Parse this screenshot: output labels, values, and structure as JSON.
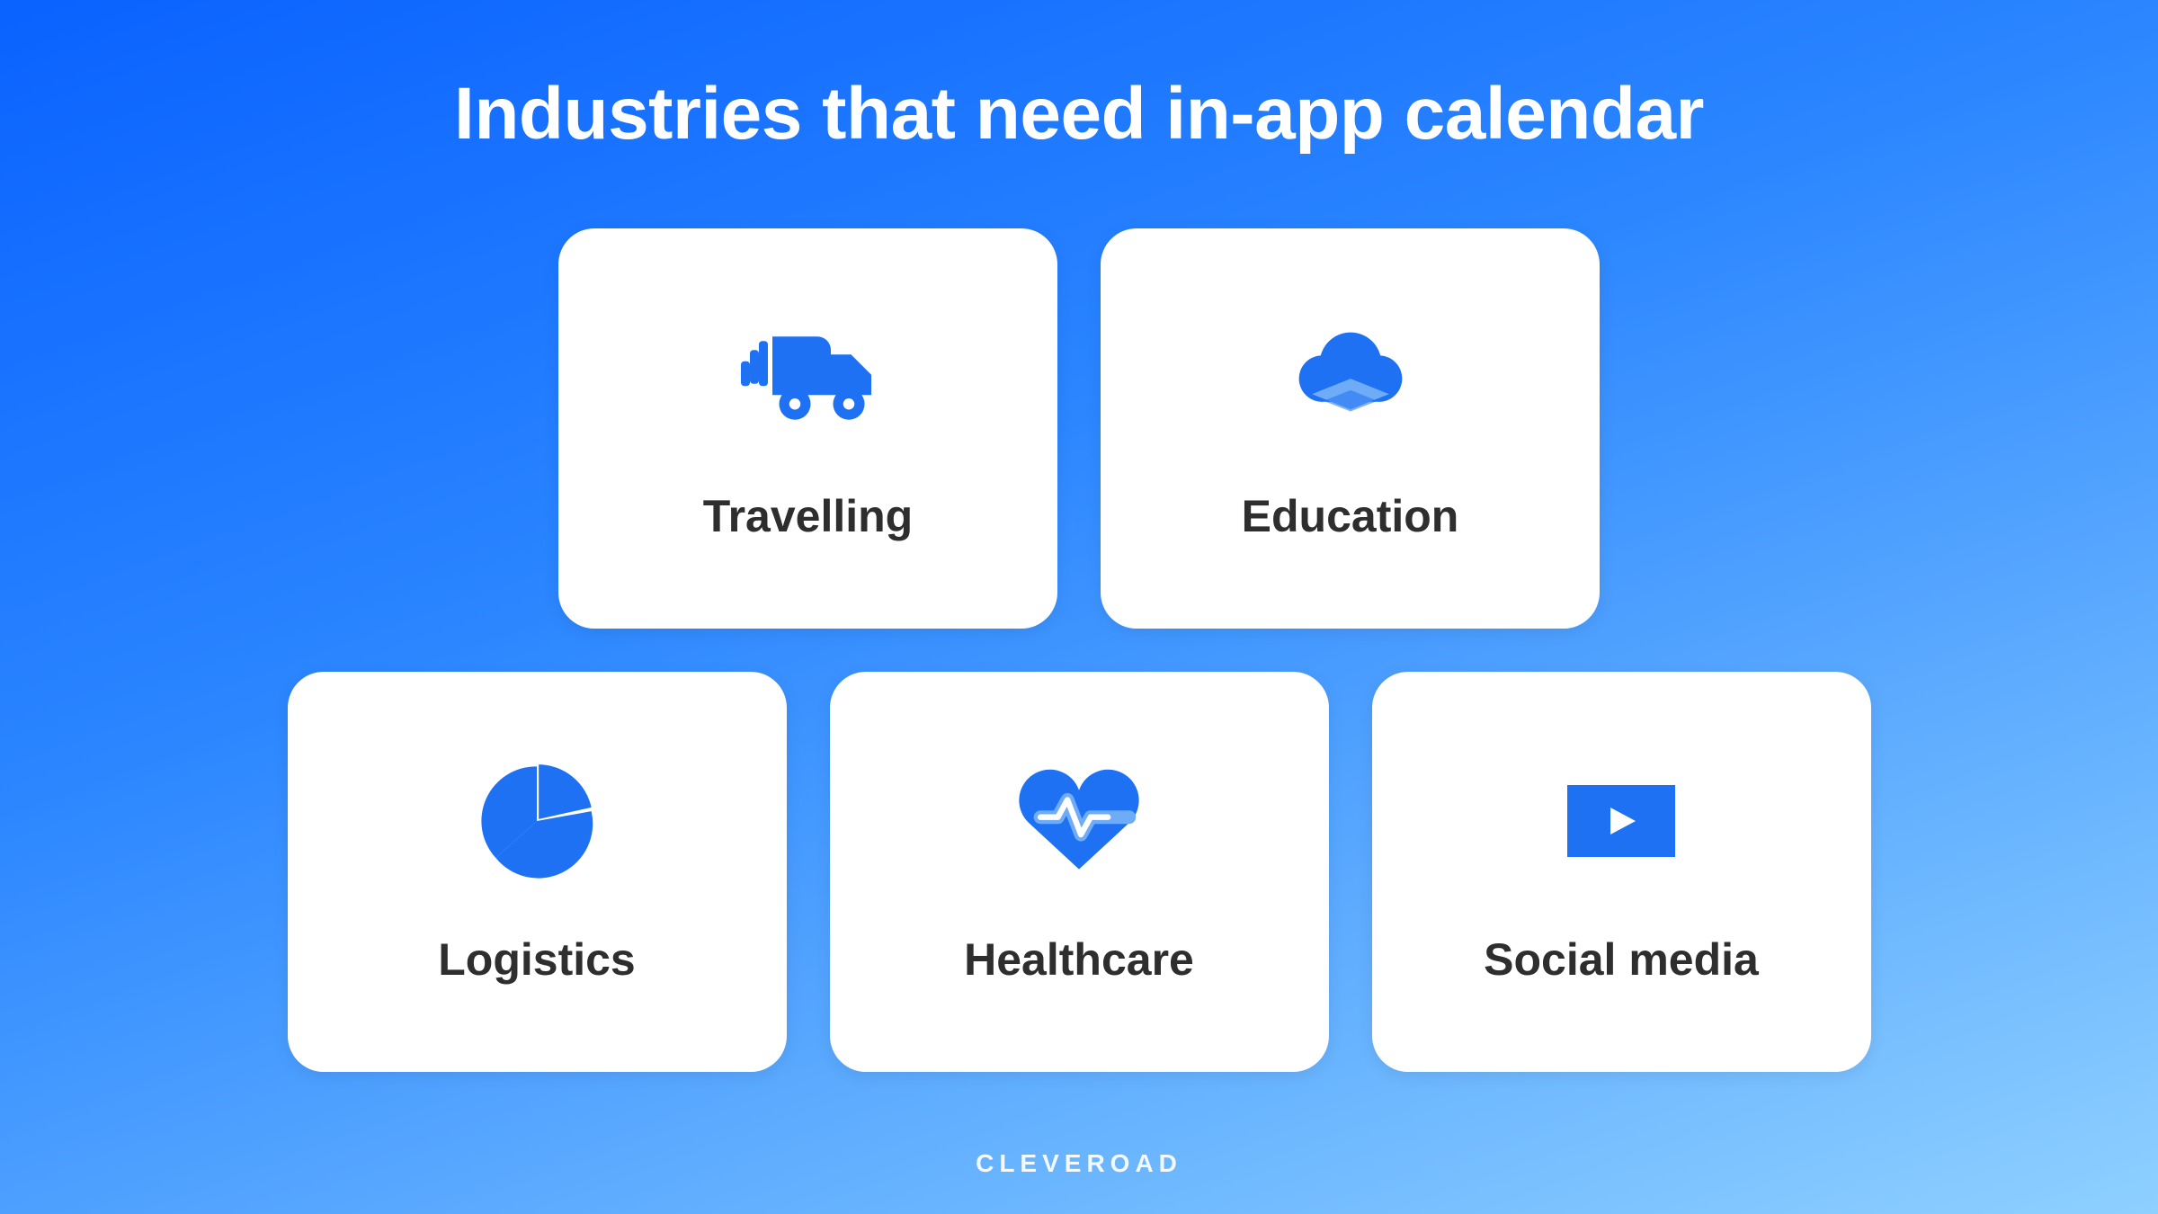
{
  "title": "Industries that need in-app calendar",
  "footer_brand": "CLEVEROAD",
  "colors": {
    "icon_primary": "#1d71f2",
    "icon_secondary": "#6facf8",
    "text": "#2e2e2e",
    "card_bg": "#ffffff"
  },
  "cards": {
    "travelling": {
      "label": "Travelling",
      "icon": "truck-icon"
    },
    "education": {
      "label": "Education",
      "icon": "cloud-cap-icon"
    },
    "logistics": {
      "label": "Logistics",
      "icon": "pie-chart-icon"
    },
    "healthcare": {
      "label": "Healthcare",
      "icon": "heart-pulse-icon"
    },
    "social": {
      "label": "Social media",
      "icon": "video-play-icon"
    }
  }
}
